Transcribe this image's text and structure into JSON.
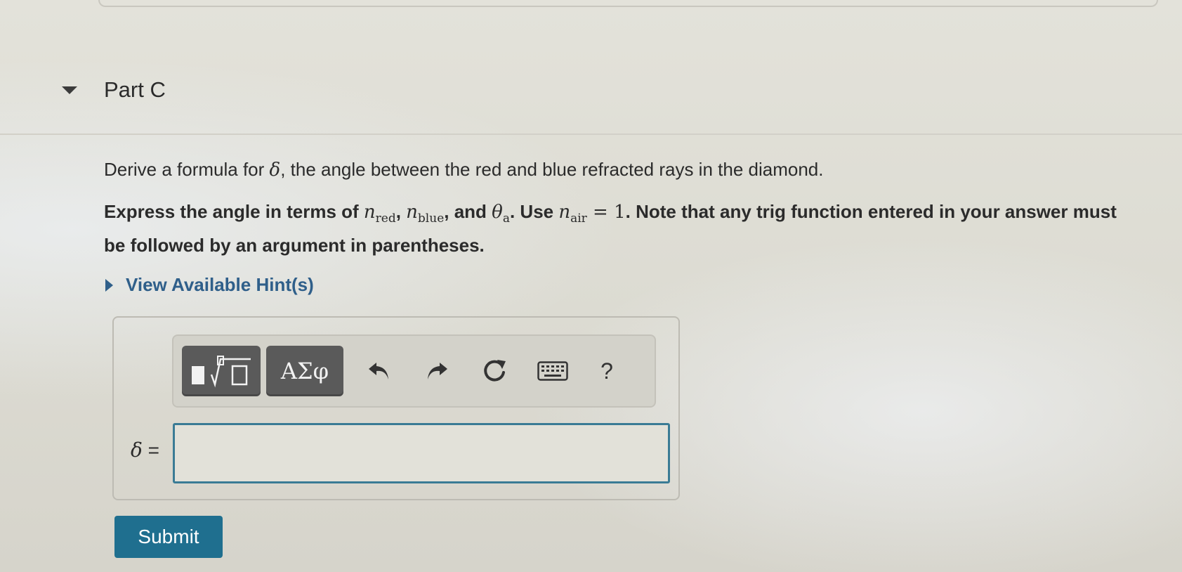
{
  "part": {
    "title": "Part C"
  },
  "question": {
    "prompt_before": "Derive a formula for ",
    "prompt_symbol": "δ",
    "prompt_after": ", the angle between the red and blue refracted rays in the diamond.",
    "instr_1": "Express the angle in terms of ",
    "n_symbol": "n",
    "sub_red": "red",
    "sep_1": ", ",
    "sub_blue": "blue",
    "sep_2": ", and ",
    "theta_symbol": "θ",
    "sub_a": "a",
    "instr_2": ". Use ",
    "sub_air": "air",
    "equals_one": " = 1",
    "instr_3": ". Note that any trig function entered in your answer must be followed by an argument in parentheses."
  },
  "hints": {
    "label": "View Available Hint(s)"
  },
  "toolbar": {
    "greek_label": "ΑΣφ",
    "help_label": "?"
  },
  "answer": {
    "symbol": "δ",
    "equals": " =",
    "value": ""
  },
  "submit": {
    "label": "Submit"
  },
  "colors": {
    "link": "#2f5f8a",
    "submit_bg": "#1f6f8f",
    "input_border": "#3a7b95",
    "toolbar_button": "#5a5a5a"
  }
}
